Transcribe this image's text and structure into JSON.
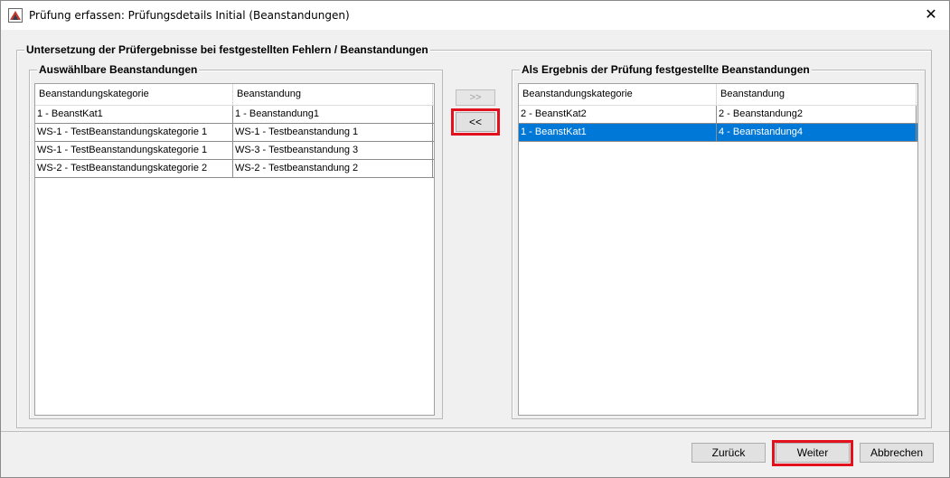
{
  "window": {
    "title": "Prüfung erfassen: Prüfungsdetails Initial (Beanstandungen)",
    "close_symbol": "✕"
  },
  "outer_group": {
    "title": "Untersetzung der Prüfergebnisse bei festgestellten Fehlern / Beanstandungen"
  },
  "left_panel": {
    "title": "Auswählbare Beanstandungen",
    "columns": [
      "Beanstandungskategorie",
      "Beanstandung"
    ],
    "rows": [
      [
        "1 - BeanstKat1",
        "1 - Beanstandung1"
      ],
      [
        "WS-1 - TestBeanstandungskategorie 1",
        "WS-1 - Testbeanstandung 1"
      ],
      [
        "WS-1 - TestBeanstandungskategorie 1",
        "WS-3 - Testbeanstandung 3"
      ],
      [
        "WS-2 - TestBeanstandungskategorie 2",
        "WS-2 - Testbeanstandung 2"
      ]
    ]
  },
  "right_panel": {
    "title": "Als Ergebnis der Prüfung festgestellte Beanstandungen",
    "columns": [
      "Beanstandungskategorie",
      "Beanstandung"
    ],
    "rows": [
      [
        "2 - BeanstKat2",
        "2 - Beanstandung2"
      ],
      [
        "1 - BeanstKat1",
        "4 - Beanstandung4"
      ]
    ],
    "selected_row": 1
  },
  "transfer": {
    "add_label": ">>",
    "remove_label": "<<"
  },
  "footer": {
    "back_label": "Zurück",
    "next_label": "Weiter",
    "cancel_label": "Abbrechen"
  },
  "colors": {
    "selection": "#0078d7",
    "highlight": "#e3101e"
  }
}
